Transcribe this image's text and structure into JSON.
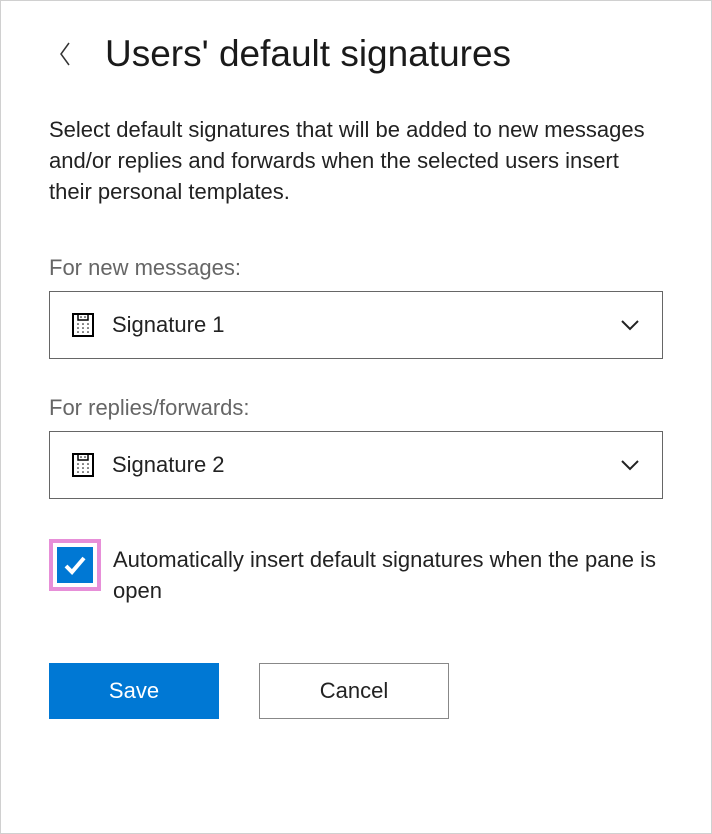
{
  "header": {
    "title": "Users' default signatures"
  },
  "description": "Select default signatures that will be added to new messages and/or replies and forwards when the selected users insert their personal templates.",
  "fields": {
    "newMessages": {
      "label": "For new messages:",
      "selected": "Signature 1"
    },
    "repliesForwards": {
      "label": "For replies/forwards:",
      "selected": "Signature 2"
    }
  },
  "checkbox": {
    "label": "Automatically insert default signatures when the pane is open",
    "checked": true
  },
  "buttons": {
    "save": "Save",
    "cancel": "Cancel"
  },
  "colors": {
    "primary": "#0078d4",
    "highlight": "#e78fd8"
  }
}
